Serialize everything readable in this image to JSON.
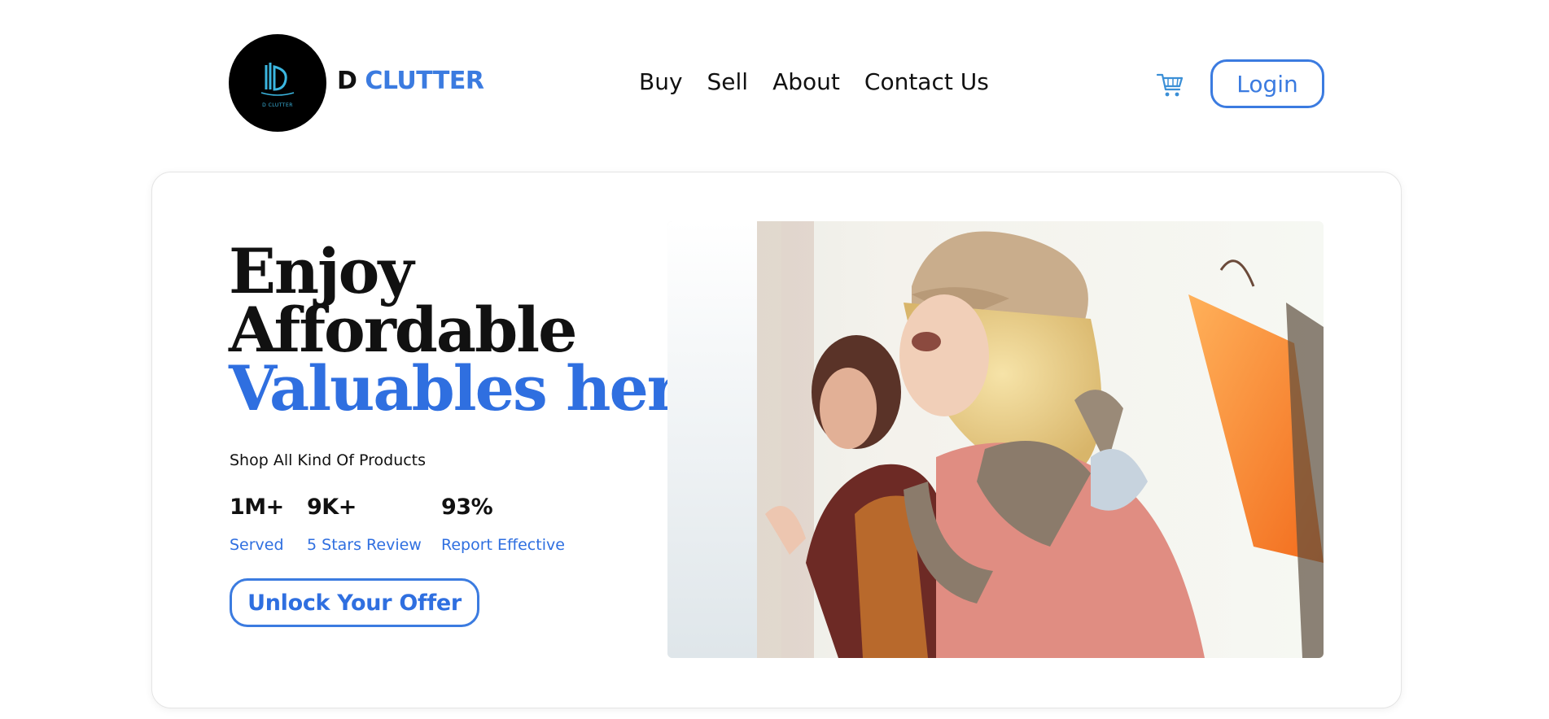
{
  "brand": {
    "d": "D",
    "clutter": "CLUTTER",
    "logo_mark_text": "D CLUTTER"
  },
  "nav": {
    "items": [
      {
        "label": "Buy"
      },
      {
        "label": "Sell"
      },
      {
        "label": "About"
      },
      {
        "label": "Contact Us"
      }
    ],
    "cart_icon": "shopping-cart-icon",
    "login_label": "Login"
  },
  "hero": {
    "headline_line1": "Enjoy",
    "headline_line2": "Affordable",
    "headline_line3": "Valuables here",
    "tagline": "Shop All Kind Of Products",
    "stats": [
      {
        "value": "1M+",
        "label": "Served"
      },
      {
        "value": "9K+",
        "label": "5 Stars Review"
      },
      {
        "value": "93%",
        "label": "Report Effective"
      }
    ],
    "cta_label": "Unlock Your Offer",
    "image": "photo of two women shopping with bags"
  },
  "colors": {
    "accent": "#3b7be0",
    "headline_blue": "#2f6fe0",
    "text": "#111111",
    "card_border": "#e4e4e4"
  }
}
